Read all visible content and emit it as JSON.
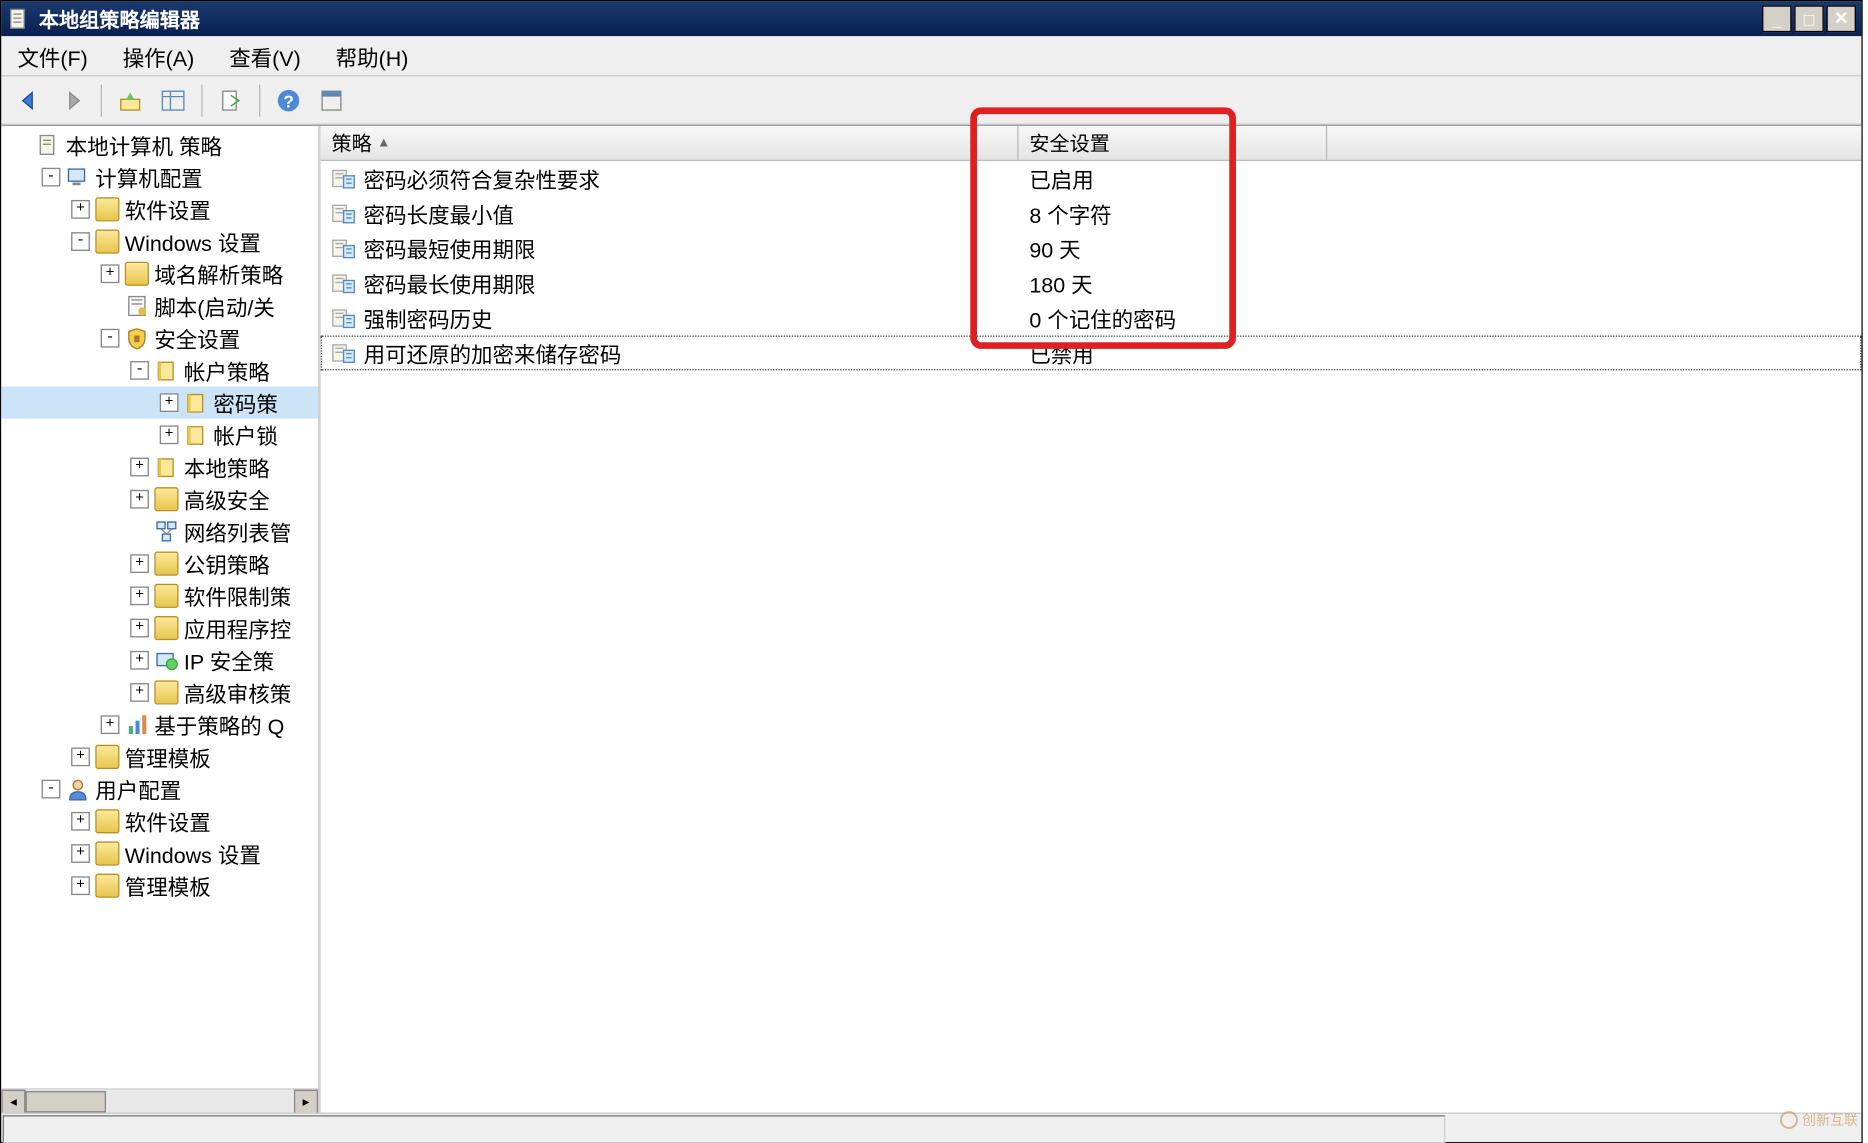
{
  "window": {
    "title": "本地组策略编辑器"
  },
  "menubar": {
    "items": [
      {
        "label": "文件(F)"
      },
      {
        "label": "操作(A)"
      },
      {
        "label": "查看(V)"
      },
      {
        "label": "帮助(H)"
      }
    ]
  },
  "toolbar": {
    "back": "后退",
    "forward": "前进",
    "up": "向上",
    "options": "显示/隐藏控制台树",
    "export": "导出列表",
    "help": "帮助",
    "properties": "属性"
  },
  "tree": {
    "nodes": [
      {
        "depth": 0,
        "toggle": "",
        "icon": "policy",
        "label": "本地计算机 策略"
      },
      {
        "depth": 1,
        "toggle": "-",
        "icon": "computer",
        "label": "计算机配置"
      },
      {
        "depth": 2,
        "toggle": "+",
        "icon": "folder",
        "label": "软件设置"
      },
      {
        "depth": 2,
        "toggle": "-",
        "icon": "folder",
        "label": "Windows 设置"
      },
      {
        "depth": 3,
        "toggle": "+",
        "icon": "folder",
        "label": "域名解析策略"
      },
      {
        "depth": 3,
        "toggle": "",
        "icon": "script",
        "label": "脚本(启动/关"
      },
      {
        "depth": 3,
        "toggle": "-",
        "icon": "shield",
        "label": "安全设置"
      },
      {
        "depth": 4,
        "toggle": "-",
        "icon": "book",
        "label": "帐户策略"
      },
      {
        "depth": 5,
        "toggle": "+",
        "icon": "book",
        "label": "密码策",
        "selected": true
      },
      {
        "depth": 5,
        "toggle": "+",
        "icon": "book",
        "label": "帐户锁"
      },
      {
        "depth": 4,
        "toggle": "+",
        "icon": "book",
        "label": "本地策略"
      },
      {
        "depth": 4,
        "toggle": "+",
        "icon": "folder",
        "label": "高级安全"
      },
      {
        "depth": 4,
        "toggle": "",
        "icon": "network",
        "label": "网络列表管"
      },
      {
        "depth": 4,
        "toggle": "+",
        "icon": "folder",
        "label": "公钥策略"
      },
      {
        "depth": 4,
        "toggle": "+",
        "icon": "folder",
        "label": "软件限制策"
      },
      {
        "depth": 4,
        "toggle": "+",
        "icon": "folder",
        "label": "应用程序控"
      },
      {
        "depth": 4,
        "toggle": "+",
        "icon": "ip",
        "label": "IP 安全策"
      },
      {
        "depth": 4,
        "toggle": "+",
        "icon": "folder",
        "label": "高级审核策"
      },
      {
        "depth": 3,
        "toggle": "+",
        "icon": "qos",
        "label": "基于策略的 Q"
      },
      {
        "depth": 2,
        "toggle": "+",
        "icon": "folder",
        "label": "管理模板"
      },
      {
        "depth": 1,
        "toggle": "-",
        "icon": "user",
        "label": "用户配置"
      },
      {
        "depth": 2,
        "toggle": "+",
        "icon": "folder",
        "label": "软件设置"
      },
      {
        "depth": 2,
        "toggle": "+",
        "icon": "folder",
        "label": "Windows 设置"
      },
      {
        "depth": 2,
        "toggle": "+",
        "icon": "folder",
        "label": "管理模板"
      }
    ]
  },
  "list": {
    "columns": [
      {
        "label": "策略",
        "sort": "▲"
      },
      {
        "label": "安全设置"
      }
    ],
    "rows": [
      {
        "policy": "密码必须符合复杂性要求",
        "setting": "已启用"
      },
      {
        "policy": "密码长度最小值",
        "setting": "8 个字符"
      },
      {
        "policy": "密码最短使用期限",
        "setting": "90 天"
      },
      {
        "policy": "密码最长使用期限",
        "setting": "180 天"
      },
      {
        "policy": "强制密码历史",
        "setting": "0 个记住的密码"
      },
      {
        "policy": "用可还原的加密来储存密码",
        "setting": "已禁用",
        "focus": true
      }
    ]
  },
  "watermark": "创新互联"
}
